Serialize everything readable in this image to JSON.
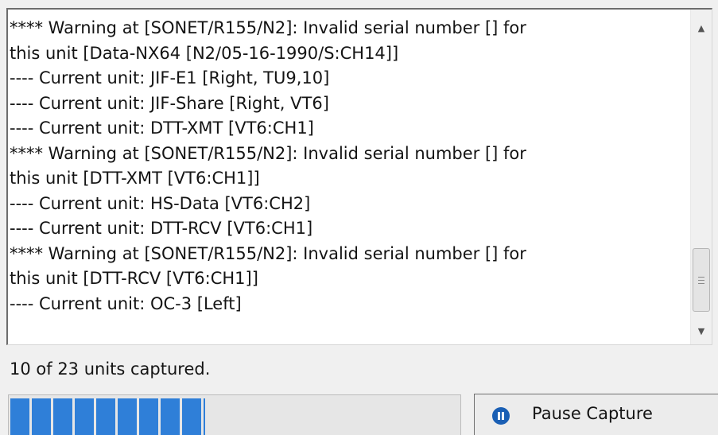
{
  "log": {
    "lines": [
      "**** Warning at [SONET/R155/N2]: Invalid serial number [] for",
      "this unit [Data-NX64 [N2/05-16-1990/S:CH14]]",
      "---- Current unit: JIF-E1 [Right, TU9,10]",
      "---- Current unit: JIF-Share [Right, VT6]",
      "---- Current unit: DTT-XMT [VT6:CH1]",
      "**** Warning at [SONET/R155/N2]: Invalid serial number [] for",
      "this unit [DTT-XMT [VT6:CH1]]",
      "---- Current unit: HS-Data [VT6:CH2]",
      "---- Current unit: DTT-RCV [VT6:CH1]",
      "**** Warning at [SONET/R155/N2]: Invalid serial number [] for",
      "this unit [DTT-RCV [VT6:CH1]]",
      "---- Current unit: OC-3 [Left]"
    ]
  },
  "status": {
    "text": "10 of 23 units captured.",
    "captured": 10,
    "total": 23
  },
  "progress": {
    "fraction": 0.435,
    "color": "#2f7fd8"
  },
  "pause_button": {
    "label": "Pause Capture",
    "icon": "pause-circle-icon",
    "icon_color": "#1a5fb4"
  },
  "icons": {
    "scroll_up": "scroll-up-arrow-icon",
    "scroll_down": "scroll-down-arrow-icon"
  }
}
